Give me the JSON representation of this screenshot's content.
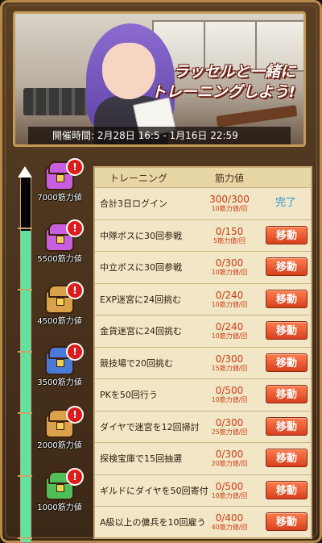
{
  "banner": {
    "title_line1": "ラッセルと一緒に",
    "title_line2": "トレーニングしよう!",
    "period": "開催時間: 2月28日 16:5 - 1月16日 22:59"
  },
  "progress": {
    "fill_fraction": 0.85,
    "milestones": [
      {
        "label": "7000筋力値",
        "color": "#c85fe0",
        "badge": "!"
      },
      {
        "label": "5500筋力値",
        "color": "#c85fe0",
        "badge": "!"
      },
      {
        "label": "4500筋力値",
        "color": "#d9a24a",
        "badge": "!"
      },
      {
        "label": "3500筋力値",
        "color": "#4a7ad9",
        "badge": "!"
      },
      {
        "label": "2000筋力値",
        "color": "#d9a24a",
        "badge": "!"
      },
      {
        "label": "1000筋力値",
        "color": "#4fbf5a",
        "badge": "!"
      }
    ]
  },
  "table": {
    "header_task": "トレーニング",
    "header_value": "筋力値",
    "rows": [
      {
        "task": "合計3日ログイン",
        "value": "300/300",
        "rate": "10筋力値/回",
        "status": "完了"
      },
      {
        "task": "中隊ボスに30回参戦",
        "value": "0/150",
        "rate": "5筋力値/回",
        "button": "移動"
      },
      {
        "task": "中立ボスに30回参戦",
        "value": "0/300",
        "rate": "10筋力値/回",
        "button": "移動"
      },
      {
        "task": "EXP迷宮に24回挑む",
        "value": "0/240",
        "rate": "10筋力値/回",
        "button": "移動"
      },
      {
        "task": "金貨迷宮に24回挑む",
        "value": "0/240",
        "rate": "10筋力値/回",
        "button": "移動"
      },
      {
        "task": "競技場で20回挑む",
        "value": "0/300",
        "rate": "15筋力値/回",
        "button": "移動"
      },
      {
        "task": "PKを50回行う",
        "value": "0/500",
        "rate": "10筋力値/回",
        "button": "移動"
      },
      {
        "task": "ダイヤで迷宮を12回掃討",
        "value": "0/300",
        "rate": "25筋力値/回",
        "button": "移動"
      },
      {
        "task": "探検宝庫で15回抽選",
        "value": "0/300",
        "rate": "20筋力値/回",
        "button": "移動"
      },
      {
        "task": "ギルドにダイヤを50回寄付",
        "value": "0/500",
        "rate": "10筋力値/回",
        "button": "移動"
      },
      {
        "task": "A級以上の傭兵を10回雇う",
        "value": "0/400",
        "rate": "40筋力値/回",
        "button": "移動"
      }
    ]
  }
}
